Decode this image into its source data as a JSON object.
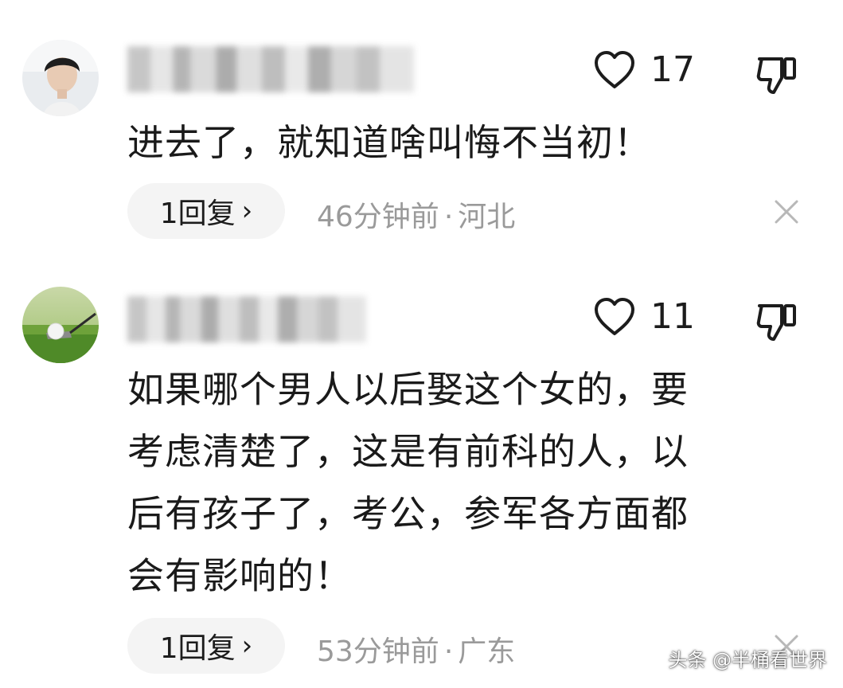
{
  "comments": [
    {
      "likes": "17",
      "text": "进去了，就知道啥叫悔不当初！",
      "reply_count": "1回复",
      "reply_chevron": "›",
      "time": "46分钟前",
      "separator": "·",
      "location": "河北",
      "avatar_icon": "person-avatar"
    },
    {
      "likes": "11",
      "text": "如果哪个男人以后娶这个女的，要\n考虑清楚了，这是有前科的人，以\n后有孩子了，考公，参军各方面都\n会有影响的！",
      "reply_count": "1回复",
      "reply_chevron": "›",
      "time": "53分钟前",
      "separator": "·",
      "location": "广东",
      "avatar_icon": "golf-ball-avatar"
    }
  ],
  "icons": {
    "like": "heart-outline-icon",
    "dislike": "thumbs-down-icon",
    "close": "close-icon"
  },
  "watermark": "头条 @半桶看世界"
}
